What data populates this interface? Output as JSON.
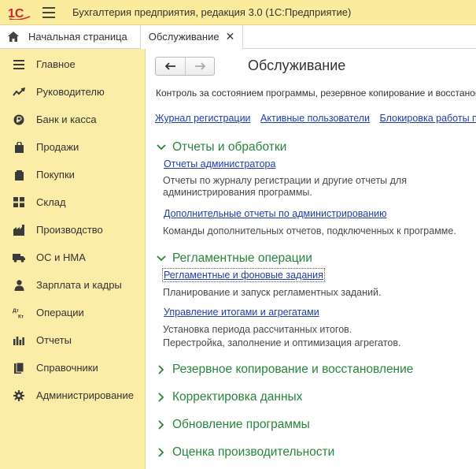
{
  "titlebar": {
    "logo_text": "1С",
    "app_title": "Бухгалтерия предприятия, редакция 3.0  (1С:Предприятие)"
  },
  "tabs": [
    {
      "label": "Начальная страница",
      "icon": "home-icon"
    },
    {
      "label": "Обслуживание",
      "close": "✕"
    }
  ],
  "sidebar": {
    "items": [
      {
        "label": "Главное",
        "icon": "menu-icon"
      },
      {
        "label": "Руководителю",
        "icon": "trend-icon"
      },
      {
        "label": "Банк и касса",
        "icon": "ruble-coin-icon"
      },
      {
        "label": "Продажи",
        "icon": "shopping-bag-icon"
      },
      {
        "label": "Покупки",
        "icon": "shopping-cart-icon"
      },
      {
        "label": "Склад",
        "icon": "warehouse-icon"
      },
      {
        "label": "Производство",
        "icon": "factory-icon"
      },
      {
        "label": "ОС и НМА",
        "icon": "truck-icon"
      },
      {
        "label": "Зарплата и кадры",
        "icon": "person-icon"
      },
      {
        "label": "Операции",
        "icon": "debit-credit-icon",
        "icon_text": "Дт Кт"
      },
      {
        "label": "Отчеты",
        "icon": "bar-chart-icon"
      },
      {
        "label": "Справочники",
        "icon": "books-icon"
      },
      {
        "label": "Администрирование",
        "icon": "gear-icon"
      }
    ]
  },
  "main": {
    "nav": {
      "back": "🡐",
      "forward": "🡒"
    },
    "title": "Обслуживание",
    "description": "Контроль за состоянием программы, резервное копирование и восстановление",
    "top_links": [
      "Журнал регистрации",
      "Активные пользователи",
      "Блокировка работы пользователей"
    ],
    "sections": [
      {
        "label": "Отчеты и обработки",
        "expanded": true,
        "items": [
          {
            "link": "Отчеты администратора",
            "desc": [
              "Отчеты по журналу регистрации и другие отчеты для",
              "администрирования программы."
            ]
          },
          {
            "link": "Дополнительные отчеты по администрированию",
            "desc": [
              "Команды дополнительных отчетов, подключенных к программе."
            ]
          }
        ]
      },
      {
        "label": "Регламентные операции",
        "expanded": true,
        "items": [
          {
            "link": "Регламентные и фоновые задания",
            "desc": [
              "Планирование и запуск регламентных заданий."
            ]
          },
          {
            "link": "Управление итогами и агрегатами",
            "desc": [
              "Установка периода рассчитанных итогов.",
              "Перестройка, заполнение и оптимизация агрегатов."
            ]
          }
        ]
      },
      {
        "label": "Резервное копирование и восстановление",
        "expanded": false
      },
      {
        "label": "Корректировка данных",
        "expanded": false
      },
      {
        "label": "Обновление программы",
        "expanded": false
      },
      {
        "label": "Оценка производительности",
        "expanded": false
      }
    ]
  },
  "colors": {
    "titlebar_bg": "#fbeb9c",
    "sidebar_bg": "#fbeda7",
    "section_green": "#27863c",
    "link_blue": "#1f3fa6",
    "logo_red": "#d8232a"
  }
}
